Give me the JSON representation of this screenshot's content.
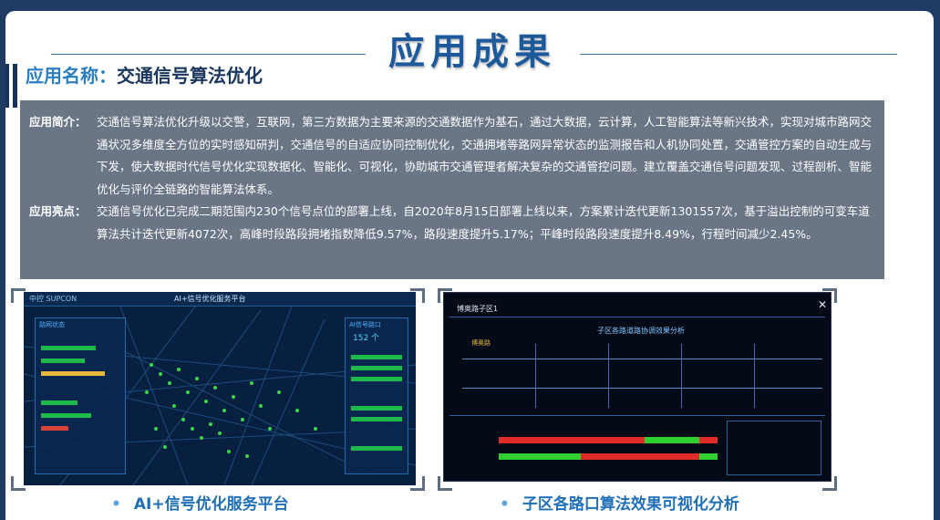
{
  "header": {
    "title": "应用成果"
  },
  "app": {
    "name_label": "应用名称：",
    "name_value": "交通信号算法优化"
  },
  "intro": {
    "summary_label": "应用简介：",
    "summary_text": "交通信号算法优化升级以交警，互联网，第三方数据为主要来源的交通数据作为基石，通过大数据，云计算，人工智能算法等新兴技术，实现对城市路网交通状况多维度全方位的实时感知研判，交通信号的自适应协同控制优化，交通拥堵等路网异常状态的监测报告和人机协同处置，交通管控方案的自动生成与下发，使大数据时代信号优化实现数据化、智能化、可视化，协助城市交通管理者解决复杂的交通管控问题。建立覆盖交通信号问题发现、过程剖析、智能优化与评价全链路的智能算法体系。",
    "highlight_label": "应用亮点：",
    "highlight_text": "交通信号优化已完成二期范围内230个信号点位的部署上线，自2020年8月15日部署上线以来，方案累计迭代更新1301557次，基于溢出控制的可变车道算法共计迭代更新4072次，高峰时段路段拥堵指数降低9.57%，路段速度提升5.17%；平峰时段路段速度提升8.49%，行程时间减少2.45%。"
  },
  "screenshots": {
    "left": {
      "caption": "AI+信号优化服务平台",
      "brand": "中控 SUPCON",
      "topbar_title": "AI+信号优化服务平台",
      "panel_title": "路网状态",
      "right_title": "AI信号路口",
      "right_count": "152 个"
    },
    "right": {
      "caption": "子区各路口算法效果可视化分析",
      "window_title": "博奥路子区1",
      "chart_title": "子区各路道路协调效果分析",
      "road": "博奥路",
      "close": "✕"
    }
  },
  "colors": {
    "title": "#1d5a9c",
    "app_name_label": "#2b7ec3",
    "intro_bg": "#6a7586",
    "caption": "#1e6fb8"
  }
}
